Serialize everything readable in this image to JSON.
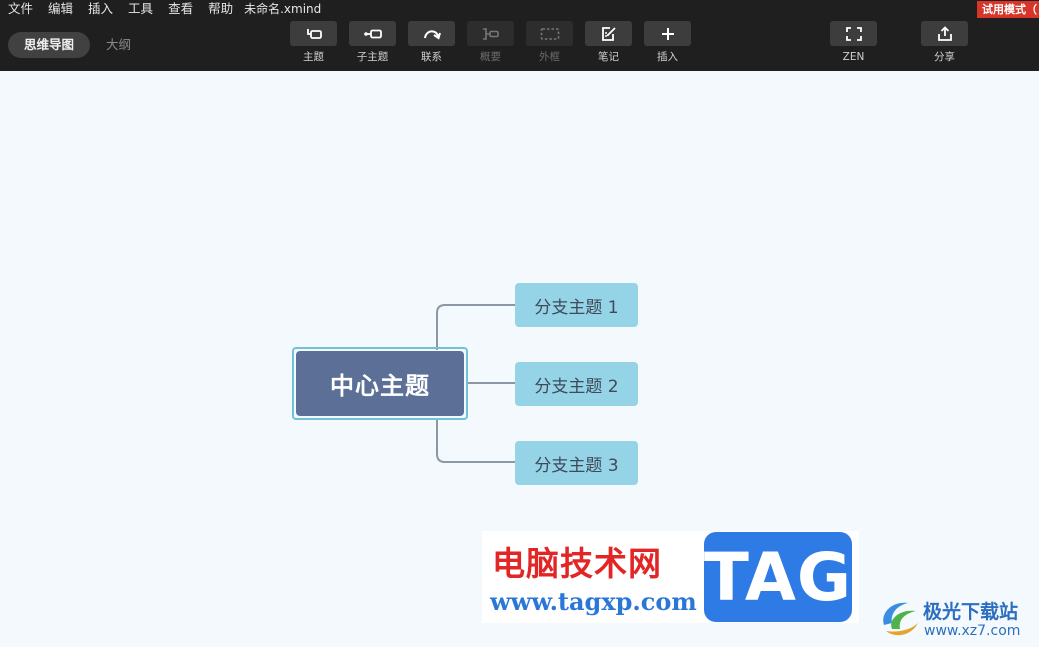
{
  "menu": {
    "items": [
      "文件",
      "编辑",
      "插入",
      "工具",
      "查看",
      "帮助"
    ],
    "file_name": "未命名.xmind",
    "trial_badge": "试用模式（"
  },
  "view_tabs": [
    {
      "label": "思维导图",
      "active": true
    },
    {
      "label": "大纲",
      "active": false
    }
  ],
  "toolbar": {
    "topic": "主题",
    "subtopic": "子主题",
    "relationship": "联系",
    "summary": "概要",
    "boundary": "外框",
    "note": "笔记",
    "insert": "插入",
    "zen": "ZEN",
    "share": "分享"
  },
  "mindmap": {
    "central": "中心主题",
    "branches": [
      "分支主题 1",
      "分支主题 2",
      "分支主题 3"
    ]
  },
  "watermark": {
    "site_cn": "电脑技术网",
    "site_url": "www.tagxp.com",
    "tag": "TAG",
    "site2_cn": "极光下载站",
    "site2_url": "www.xz7.com"
  },
  "colors": {
    "toolbar_bg": "#1f1f1f",
    "canvas_bg": "#f4f9fd",
    "central_fill": "#5b6f97",
    "central_border": "#6ec3d9",
    "branch_fill": "#95d3e6",
    "connector": "#8c98a6"
  }
}
